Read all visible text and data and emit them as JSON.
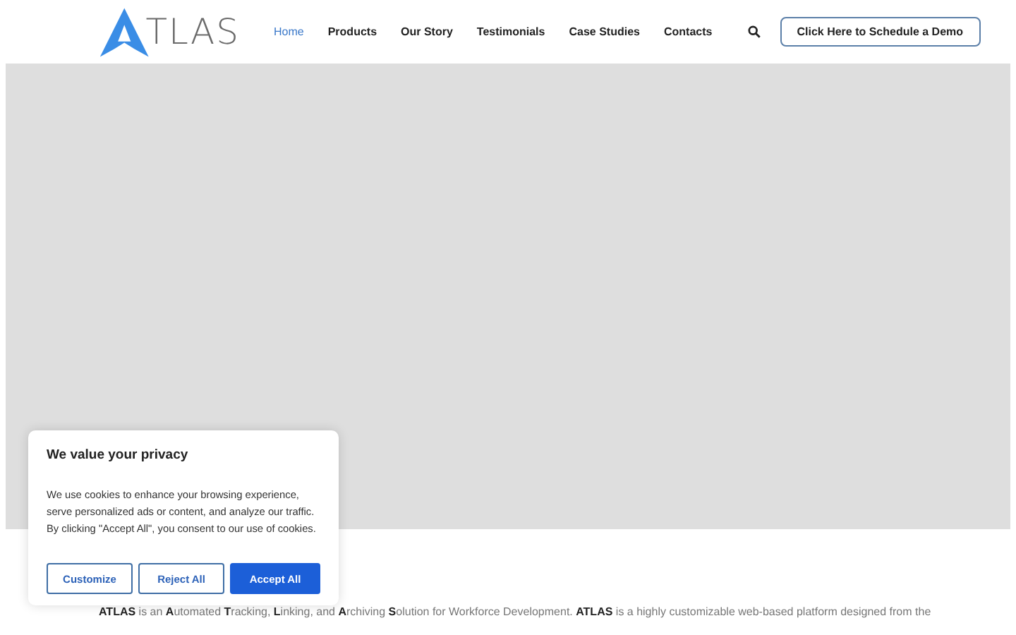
{
  "header": {
    "logo_text": "TLAS",
    "nav": [
      {
        "label": "Home",
        "selected": true
      },
      {
        "label": "Products",
        "selected": false
      },
      {
        "label": "Our Story",
        "selected": false
      },
      {
        "label": "Testimonials",
        "selected": false
      },
      {
        "label": "Case Studies",
        "selected": false
      },
      {
        "label": "Contacts",
        "selected": false
      }
    ],
    "cta": "Click Here to Schedule a Demo"
  },
  "intro": "**ATLAS** is an **A**utomated **T**racking, **L**inking, and **A**rchiving **S**olution for Workforce Development. **ATLAS** is a highly customizable web-based platform designed from the",
  "cookie_banner": {
    "title": "We value your privacy",
    "text": "We use cookies to enhance your browsing experience, serve personalized ads or content, and analyze our traffic. By clicking \"Accept All\", you consent to our use of cookies.",
    "buttons": [
      {
        "label": "Customize",
        "kind": "outline"
      },
      {
        "label": "Reject All",
        "kind": "outline"
      },
      {
        "label": "Accept All",
        "kind": "primary"
      }
    ]
  }
}
